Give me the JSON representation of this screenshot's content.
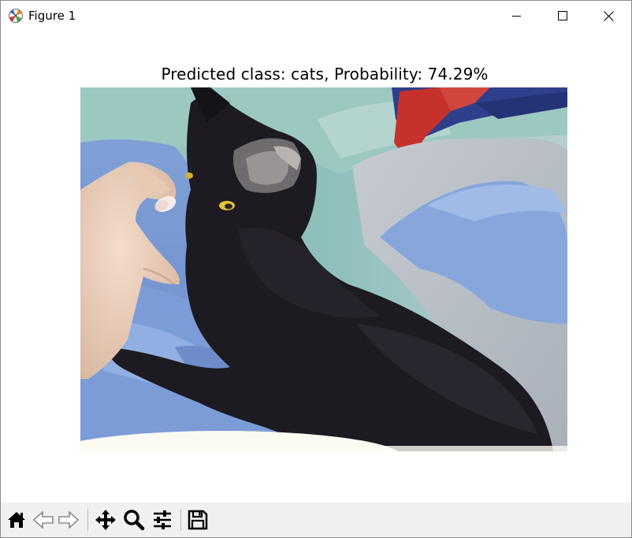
{
  "window": {
    "title": "Figure 1"
  },
  "figure": {
    "title": "Predicted class: cats, Probability: 74.29%",
    "predicted_class": "cats",
    "probability_percent": 74.29,
    "image_subject": "black cat lying on blue blanket with a hand petting it"
  },
  "toolbar": {
    "buttons": [
      "home-icon",
      "back-icon",
      "forward-icon",
      "pan-icon",
      "zoom-icon",
      "configure-subplots-icon",
      "save-icon"
    ]
  },
  "colors": {
    "toolbar_bg": "#f0f0f0",
    "window_bg": "#ffffff"
  }
}
